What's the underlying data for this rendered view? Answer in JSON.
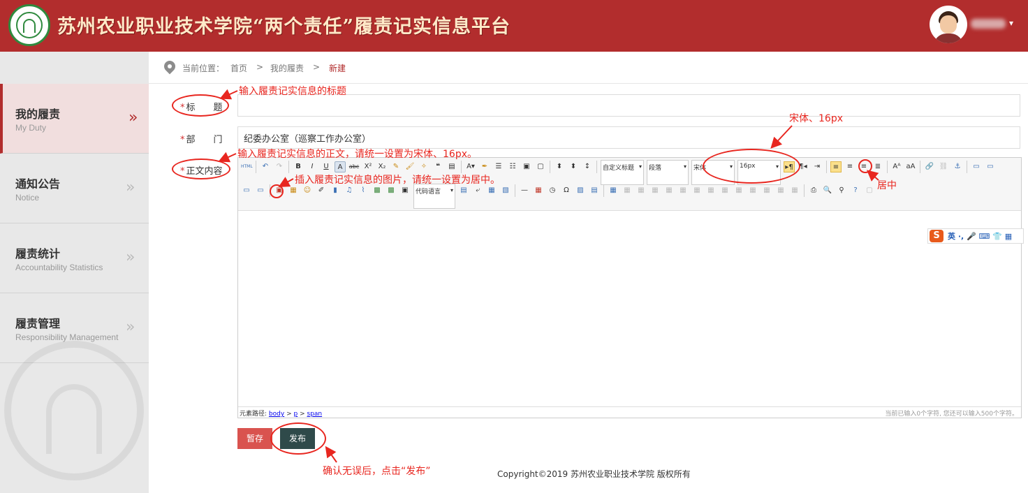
{
  "header": {
    "site_title": "苏州农业职业技术学院“两个责任”履责记实信息平台",
    "user_caret": "▾"
  },
  "sidebar": {
    "items": [
      {
        "cn": "我的履责",
        "en": "My Duty",
        "arrow": "»"
      },
      {
        "cn": "通知公告",
        "en": "Notice",
        "arrow": "»"
      },
      {
        "cn": "履责统计",
        "en": "Accountability Statistics",
        "arrow": "»"
      },
      {
        "cn": "履责管理",
        "en": "Responsibility Management",
        "arrow": "»"
      }
    ]
  },
  "breadcrumb": {
    "label": "当前位置：",
    "home": "首页",
    "sep": ">",
    "section": "我的履责",
    "current": "新建"
  },
  "form": {
    "required_mark": "*",
    "title_label": "标　　题",
    "title_value": "",
    "dept_label": "部　　门",
    "dept_value": "纪委办公室（巡察工作办公室）",
    "body_label": "正文内容"
  },
  "editor": {
    "combo_heading": "自定义标题",
    "combo_paragraph": "段落",
    "combo_font": "宋体",
    "combo_size": "16px",
    "combo_code": "代码语言",
    "path_label": "元素路径:",
    "path_body": "body",
    "path_p": "p",
    "path_span": "span",
    "path_sep": ">",
    "char_count": "当前已输入0个字符, 您还可以输入500个字符。",
    "caret": "▾"
  },
  "ime": {
    "logo": "S",
    "tools": "英 ·, 🎤 ⌨ 👕 ▦"
  },
  "buttons": {
    "draft": "暂存",
    "publish": "发布"
  },
  "footer": {
    "copyright": "Copyright©2019 苏州农业职业技术学院 版权所有"
  },
  "annotations": {
    "title_hint": "输入履责记实信息的标题",
    "body_hint": "输入履责记实信息的正文，请统一设置为宋体、16px。",
    "image_hint": "插入履责记实信息的图片，请统一设置为居中。",
    "font_hint": "宋体、16px",
    "center_hint": "居中",
    "publish_hint": "确认无误后，点击“发布”"
  },
  "colors": {
    "brand_red": "#b22d2d",
    "annotation_red": "#e8261f",
    "publish_dark": "#2f4a4a"
  }
}
